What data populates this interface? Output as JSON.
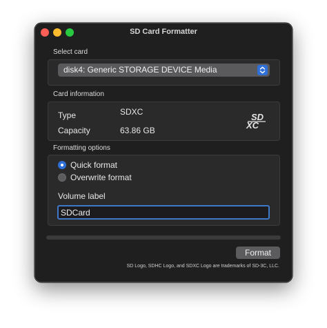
{
  "window": {
    "title": "SD Card Formatter"
  },
  "select_card": {
    "label": "Select card",
    "selected": "disk4: Generic STORAGE DEVICE Media"
  },
  "card_info": {
    "label": "Card information",
    "type_key": "Type",
    "type_value": "SDXC",
    "capacity_key": "Capacity",
    "capacity_value": "63.86 GB",
    "logo_icon": "sdxc-logo-icon"
  },
  "formatting": {
    "label": "Formatting options",
    "quick_format": "Quick format",
    "overwrite_format": "Overwrite format",
    "selected_option": "Quick format",
    "volume_label": "Volume label",
    "volume_value": "SDCard"
  },
  "progress": {
    "value": 0
  },
  "actions": {
    "format_label": "Format"
  },
  "footer": {
    "trademark": "SD Logo, SDHC Logo, and SDXC Logo are trademarks of SD-3C, LLC."
  },
  "colors": {
    "accent": "#2f6fd8",
    "window_bg": "#1f1f20",
    "close": "#ff5f57",
    "minimize": "#febc2e",
    "maximize": "#28c840"
  }
}
